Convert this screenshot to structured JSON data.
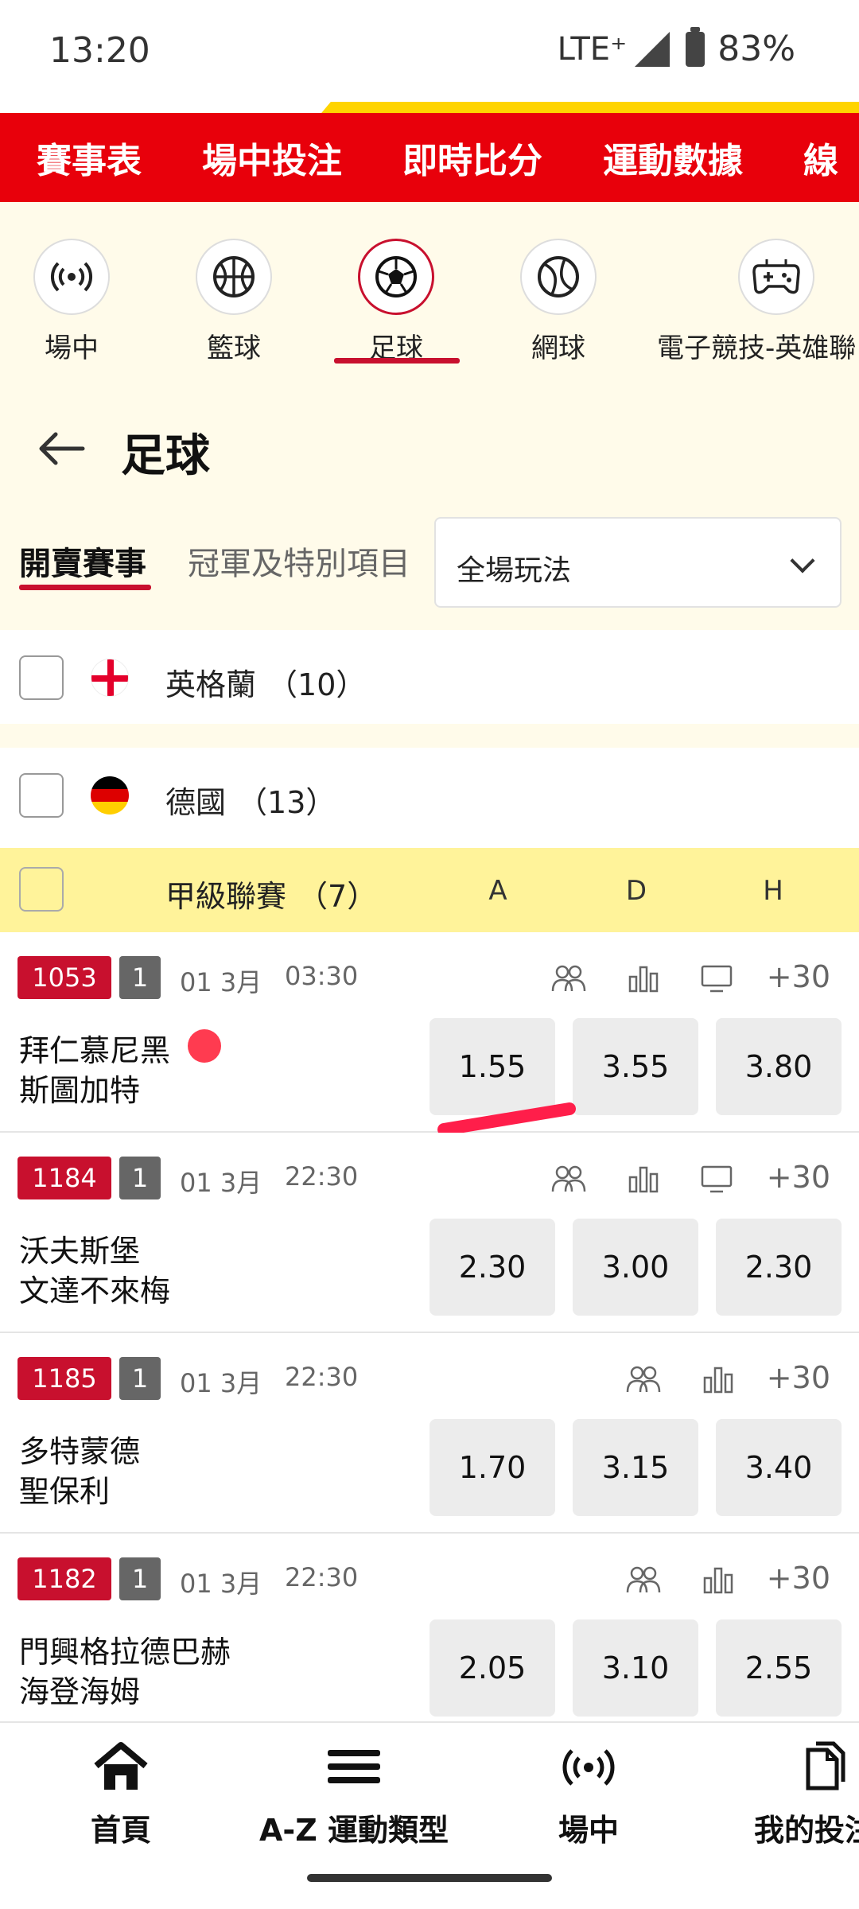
{
  "status": {
    "time": "13:20",
    "network": "LTE⁺",
    "battery": "83%"
  },
  "top_nav": [
    "賽事表",
    "場中投注",
    "即時比分",
    "運動數據",
    "線"
  ],
  "sports": [
    {
      "label": "場中",
      "icon": "live-broadcast-icon"
    },
    {
      "label": "籃球",
      "icon": "basketball-icon"
    },
    {
      "label": "足球",
      "icon": "soccer-ball-icon",
      "active": true
    },
    {
      "label": "網球",
      "icon": "tennis-ball-icon"
    },
    {
      "label": "電子競技-英雄聯",
      "icon": "gamepad-icon"
    }
  ],
  "page": {
    "title": "足球"
  },
  "tabs": {
    "open": "開賣賽事",
    "special": "冠軍及特別項目"
  },
  "market_select": {
    "value": "全場玩法"
  },
  "countries": [
    {
      "name": "英格蘭",
      "count": "（10）"
    },
    {
      "name": "德國",
      "count": "（13）"
    }
  ],
  "league": {
    "name": "甲級聯賽",
    "count": "（7）",
    "col_a": "A",
    "col_d": "D",
    "col_h": "H"
  },
  "matches": [
    {
      "no": "1053",
      "day": "1",
      "date": "01 3月",
      "time": "03:30",
      "home": "拜仁慕尼黑",
      "away": "斯圖加特",
      "odds": [
        "1.55",
        "3.55",
        "3.80"
      ],
      "more": "+30"
    },
    {
      "no": "1184",
      "day": "1",
      "date": "01 3月",
      "time": "22:30",
      "home": "沃夫斯堡",
      "away": "文達不來梅",
      "odds": [
        "2.30",
        "3.00",
        "2.30"
      ],
      "more": "+30"
    },
    {
      "no": "1185",
      "day": "1",
      "date": "01 3月",
      "time": "22:30",
      "home": "多特蒙德",
      "away": "聖保利",
      "odds": [
        "1.70",
        "3.15",
        "3.40"
      ],
      "more": "+30"
    },
    {
      "no": "1182",
      "day": "1",
      "date": "01 3月",
      "time": "22:30",
      "home": "門興格拉德巴赫",
      "away": "海登海姆",
      "odds": [
        "2.05",
        "3.10",
        "2.55"
      ],
      "more": "+30"
    }
  ],
  "bottom_nav": [
    {
      "label": "首頁",
      "icon": "home-icon"
    },
    {
      "label": "A-Z 運動類型",
      "icon": "menu-icon"
    },
    {
      "label": "場中",
      "icon": "live-broadcast-icon"
    },
    {
      "label": "我的投注",
      "icon": "documents-icon"
    }
  ],
  "colors": {
    "brand_red": "#e8000b",
    "accent_red": "#c8102e",
    "league_yellow": "#fff39a",
    "cream": "#fffbea"
  }
}
